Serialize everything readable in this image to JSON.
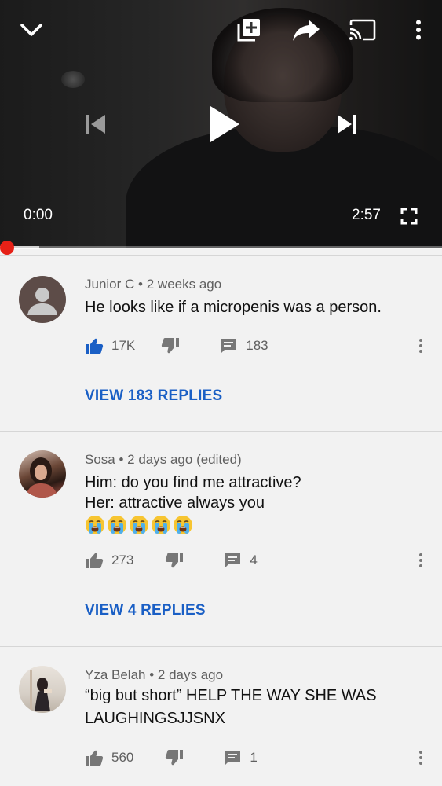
{
  "player": {
    "current_time": "0:00",
    "duration": "2:57",
    "progress_percent": 0,
    "controls": {
      "minimize": "chevron-down-icon",
      "add_to_playlist": "playlist-add-icon",
      "share": "share-icon",
      "cast": "cast-icon",
      "more": "more-vertical-icon",
      "previous": "skip-previous-icon",
      "play": "play-icon",
      "next": "skip-next-icon",
      "fullscreen": "fullscreen-icon"
    },
    "colors": {
      "progress_knob": "#e62117"
    }
  },
  "comments": [
    {
      "author": "Junior C",
      "time": "2 weeks ago",
      "text_lines": [
        "He looks like if a micropenis was a person."
      ],
      "likes": "17K",
      "liked": true,
      "reply_count": "183",
      "view_replies": "VIEW 183 REPLIES"
    },
    {
      "author": "Sosa",
      "time": "2 days ago (edited)",
      "text_lines": [
        "Him: do you find me attractive?",
        "Her: attractive always you"
      ],
      "emoji_count": 5,
      "likes": "273",
      "liked": false,
      "reply_count": "4",
      "view_replies": "VIEW 4 REPLIES"
    },
    {
      "author": "Yza Belah",
      "time": "2 days ago",
      "text_lines": [
        "“big but short” HELP THE WAY SHE WAS",
        "LAUGHINGSJJSNX"
      ],
      "likes": "560",
      "liked": false,
      "reply_count": "1"
    }
  ],
  "colors": {
    "accent_blue": "#1a5fc5",
    "background": "#f2f2f2"
  }
}
